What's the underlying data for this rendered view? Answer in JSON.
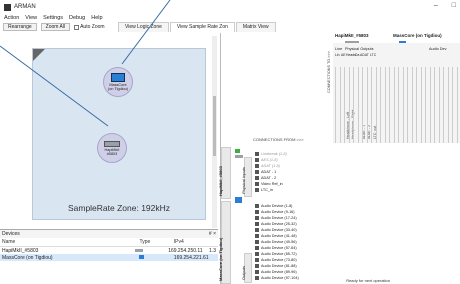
{
  "window": {
    "title": "ARMAN",
    "controls": [
      "–",
      "□"
    ]
  },
  "menu": [
    "Action",
    "View",
    "Settings",
    "Debug",
    "Help"
  ],
  "toolbar": {
    "rearrange": "Rearrange",
    "zoom_all": "Zoom All",
    "auto_zoom": "Auto Zoom",
    "view_logic_zone": "View Logic Zone"
  },
  "tabs": [
    {
      "label": "View Sample Rate Zon"
    },
    {
      "label": "Matrix View"
    }
  ],
  "canvas": {
    "zone_label": "SampleRate Zone: 192kHz",
    "nodes": [
      {
        "name": "MassCore",
        "sub": "(on Tigdiou)"
      },
      {
        "name": "HapiMkII",
        "sub": "#5803"
      }
    ]
  },
  "devices": {
    "header": "Devices",
    "header_icons": "# ×",
    "columns": [
      "Name",
      "Type",
      "IPv4",
      "Ver"
    ],
    "rows": [
      {
        "name": "HapiMkII_#5803",
        "type": "",
        "ip": "169.254.250.11",
        "ver": "1.3",
        "selected": false
      },
      {
        "name": "MassCore (on Tigdiou)",
        "type": "",
        "ip": "169.254.221.61",
        "ver": "",
        "selected": true
      }
    ]
  },
  "matrix": {
    "dest_headers": [
      {
        "label": "HapiMkII_#5803"
      },
      {
        "label": "MassCore (on Tigdiou)"
      }
    ],
    "dest_subgroups": [
      "Line",
      "Physical Outputs",
      "Audio Dev"
    ],
    "sub_labels": [
      "Lin",
      "AE",
      "Heads",
      "Da",
      "ADAT",
      "LTC"
    ],
    "connections_to": "CONNECTIONS TO >>>",
    "connections_from": "CONNECTIONS FROM >>>",
    "col_labels": [
      "Headphone - Left",
      "Headphone - Right",
      "ADAT - 1",
      "ADAT - 2",
      "LTC_out"
    ],
    "src_group_1": "HapiMkII_#5803",
    "src_group_1_sub": "Physical Inputs",
    "src_rows_1": [
      {
        "label": "Linebreak (1-8)",
        "dim": true
      },
      {
        "label": "AES (1-8)",
        "dim": true
      },
      {
        "label": "ADAT (1-8)",
        "dim": true
      },
      {
        "label": "ADAT - 1",
        "dim": false
      },
      {
        "label": "ADAT - 2",
        "dim": false
      },
      {
        "label": "Video Ref_in",
        "dim": false
      },
      {
        "label": "LTC_in",
        "dim": false
      }
    ],
    "src_group_2": "MassCore (on Tigdiou)",
    "src_group_2_sub": "Outputs",
    "src_rows_2": [
      {
        "label": "Audio Device (1-8)"
      },
      {
        "label": "Audio Device (9-16)"
      },
      {
        "label": "Audio Device (17-24)"
      },
      {
        "label": "Audio Device (25-32)"
      },
      {
        "label": "Audio Device (33-40)"
      },
      {
        "label": "Audio Device (41-48)"
      },
      {
        "label": "Audio Device (49-56)"
      },
      {
        "label": "Audio Device (57-64)"
      },
      {
        "label": "Audio Device (65-72)"
      },
      {
        "label": "Audio Device (73-80)"
      },
      {
        "label": "Audio Device (81-88)"
      },
      {
        "label": "Audio Device (89-96)"
      },
      {
        "label": "Audio Device (97-104)"
      }
    ]
  },
  "status": "Ready for next operation",
  "colors": {
    "canvas_bg": "#d9e6f2",
    "node_bg": "#cfcfe8",
    "device_blue": "#2a7fd4",
    "pointer": "#3a6ea5"
  }
}
